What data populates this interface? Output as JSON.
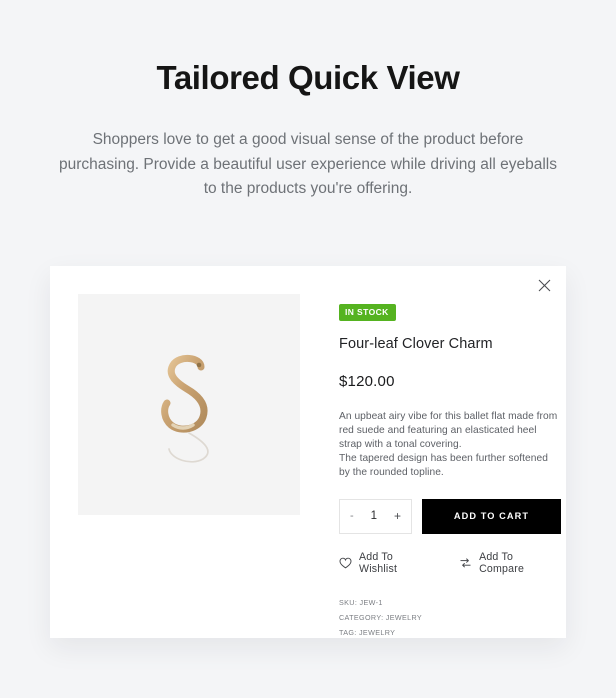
{
  "header": {
    "title": "Tailored Quick View",
    "subtitle": "Shoppers love to get a good visual sense of the product before purchasing. Provide a beautiful user experience while driving all eyeballs to the products you're offering."
  },
  "quickview": {
    "close_label": "×",
    "gallery": {
      "image_alt": "Gold S-shaped clover charm pendant on chain"
    },
    "badge": "IN STOCK",
    "badge_color": "#55b320",
    "product_title": "Four-leaf Clover Charm",
    "price": "$120.00",
    "description": [
      "An upbeat airy vibe for this ballet flat made from red suede and featuring an elasticated heel strap with a tonal covering.",
      "The tapered design has been further softened by the rounded topline."
    ],
    "quantity": {
      "decrement_label": "-",
      "value": "1",
      "increment_label": "+"
    },
    "add_to_cart_label": "ADD TO CART",
    "actions": [
      {
        "icon": "heart-icon",
        "label": "Add To Wishlist"
      },
      {
        "icon": "compare-icon",
        "label": "Add To Compare"
      }
    ],
    "meta": [
      "SKU: JEW-1",
      "CATEGORY: JEWELRY",
      "TAG: JEWELRY"
    ]
  },
  "colors": {
    "page_background": "#f4f5f7",
    "card_background": "#ffffff",
    "gallery_background": "#f4f4f4",
    "cart_button": "#000000",
    "title_color": "#151515",
    "subtitle_color": "#6e7277"
  }
}
